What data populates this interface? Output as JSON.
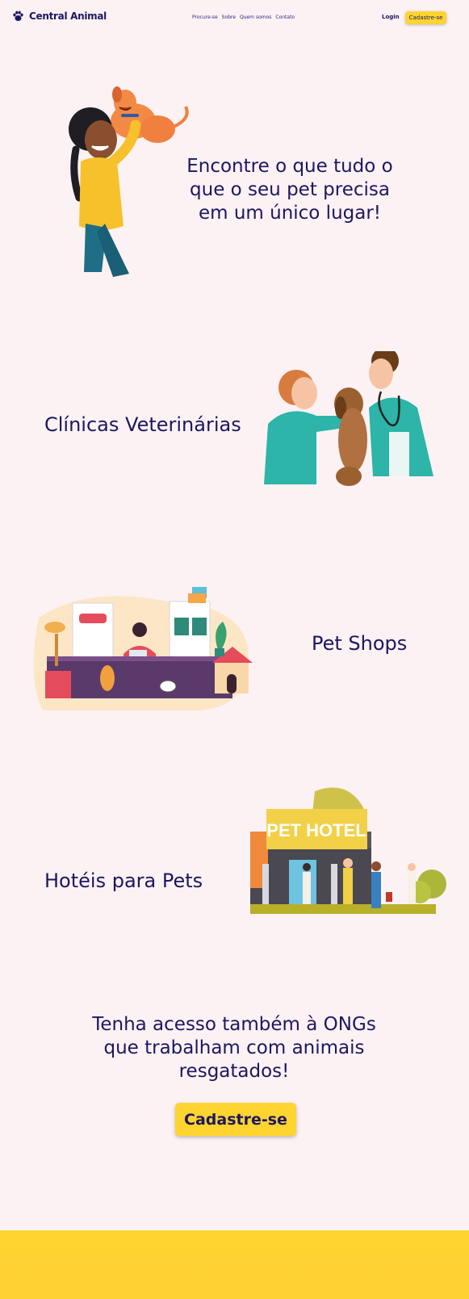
{
  "header": {
    "brand": "Central Animal",
    "logo_icon": "paw-icon",
    "nav": [
      "Procure-se",
      "Sobre",
      "Quem somos",
      "Contato"
    ],
    "login": "Login",
    "signup": "Cadastre-se"
  },
  "hero": {
    "text": "Encontre o que tudo o que o seu pet precisa em um único lugar!",
    "illustration": "woman-holding-dog-illustration"
  },
  "sections": [
    {
      "label": "Clínicas Veterinárias",
      "illustration": "vet-clinic-illustration"
    },
    {
      "label": "Pet Shops",
      "illustration": "pet-shop-illustration"
    },
    {
      "label": "Hotéis para Pets",
      "illustration": "pet-hotel-illustration",
      "sign": "PET HOTEL"
    }
  ],
  "ong": {
    "text": "Tenha acesso também à ONGs que trabalham com animais resgatados!",
    "button": "Cadastre-se"
  },
  "colors": {
    "background": "#fcf2f4",
    "primary_text": "#1c1760",
    "accent": "#fed430"
  }
}
